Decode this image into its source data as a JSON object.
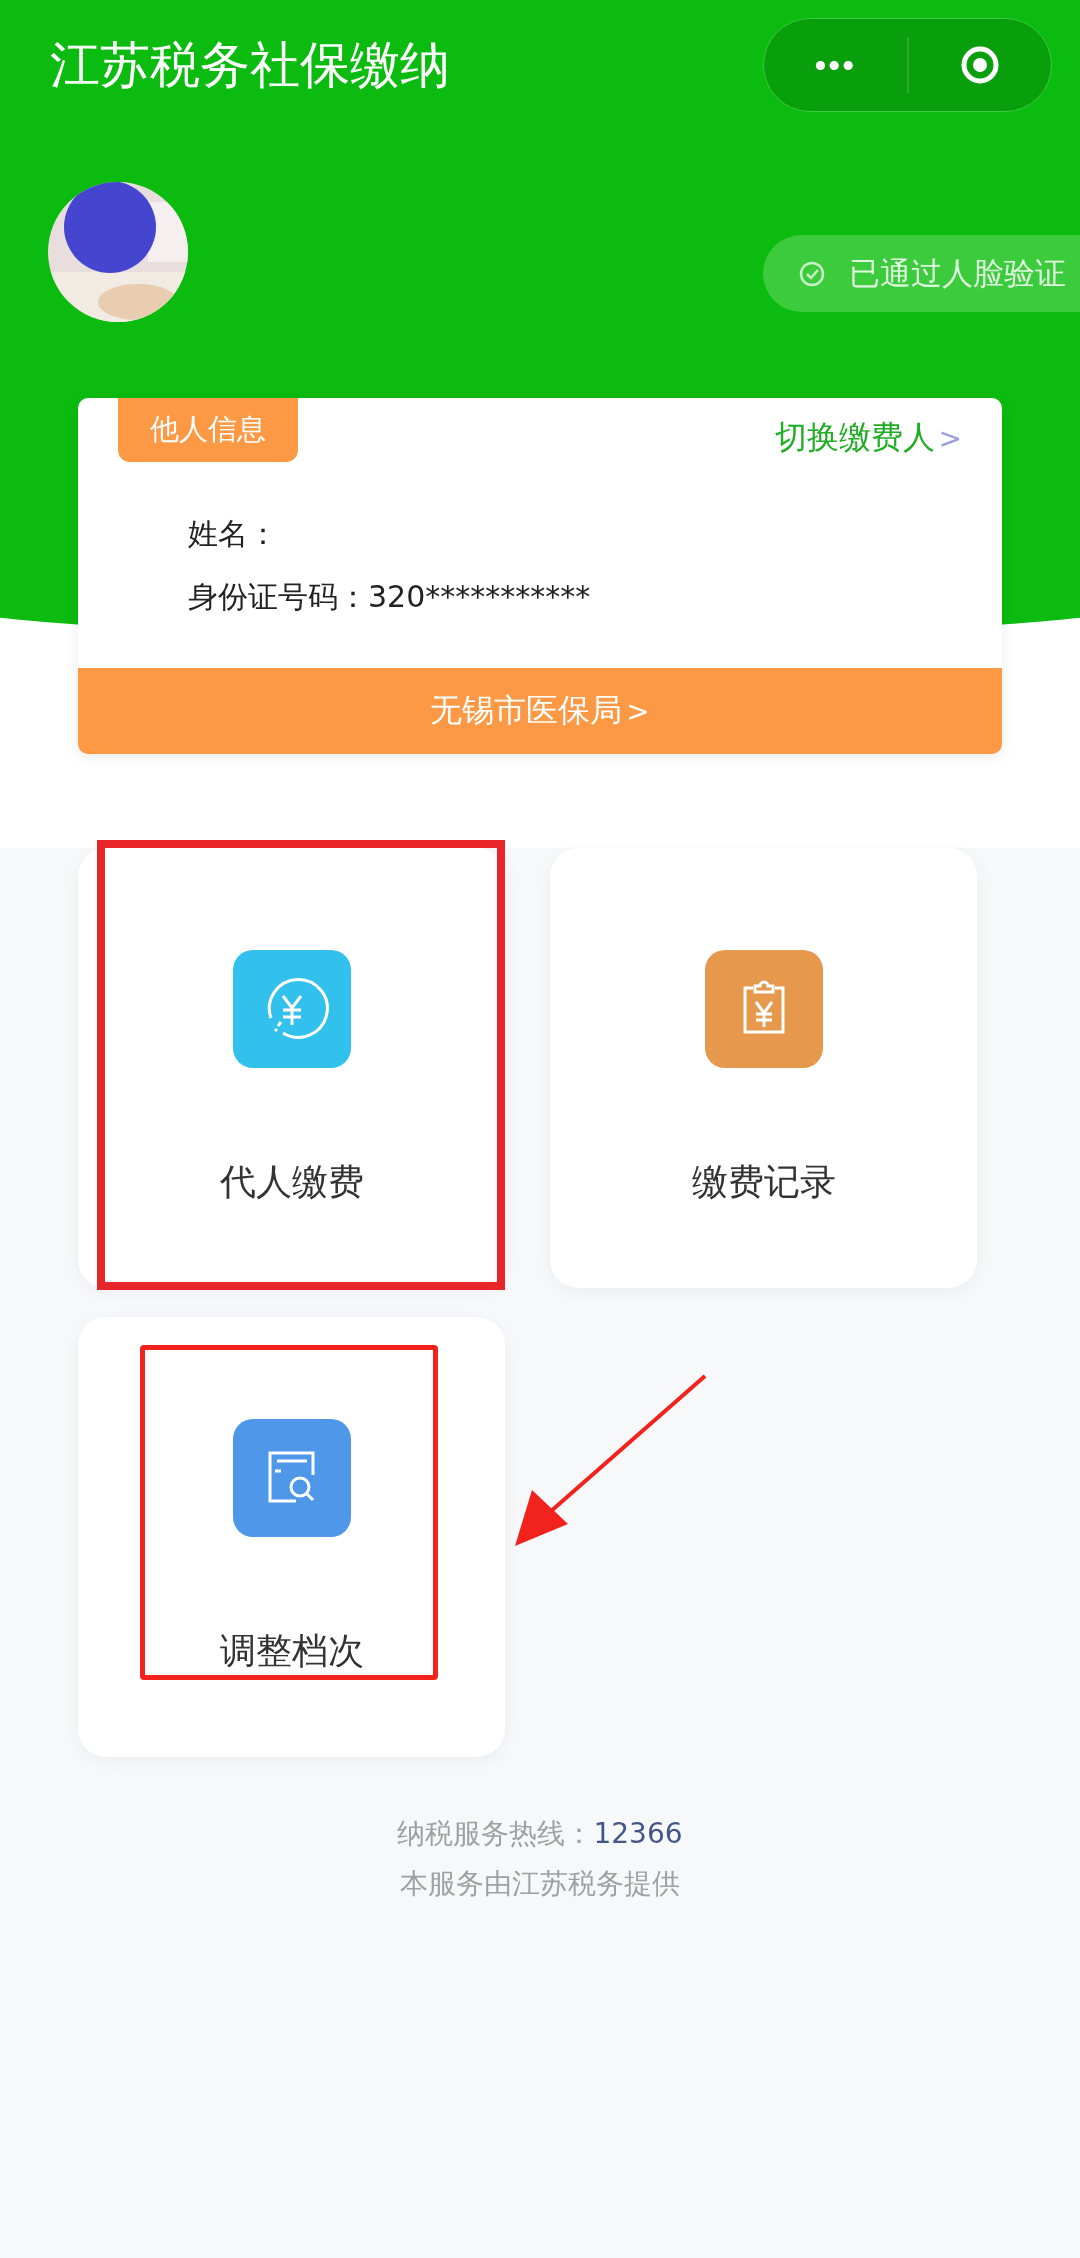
{
  "title": "江苏税务社保缴纳",
  "capsule": {
    "more": "•••"
  },
  "face_badge": {
    "label": "已通过人脸验证",
    "verified": true
  },
  "card": {
    "tag": "他人信息",
    "switch_link": "切换缴费人",
    "switch_arrow": ">",
    "fields": [
      {
        "label": "姓名："
      },
      {
        "label": "身份证号码：",
        "value": "320***********"
      }
    ],
    "agency": "无锡市医保局",
    "agency_arrow": ">"
  },
  "tiles": [
    {
      "label": "代人缴费",
      "kind": "pay",
      "color": "#32c1ec",
      "highlighted": true
    },
    {
      "label": "缴费记录",
      "kind": "record",
      "color": "#e6994c",
      "highlighted": false
    },
    {
      "label": "调整档次",
      "kind": "adjust",
      "color": "#4f97e8",
      "highlighted": true
    }
  ],
  "annotation_arrow": true,
  "footer": {
    "hotline_label": "纳税服务热线：",
    "hotline": "12366",
    "provider": "本服务由江苏税务提供"
  }
}
